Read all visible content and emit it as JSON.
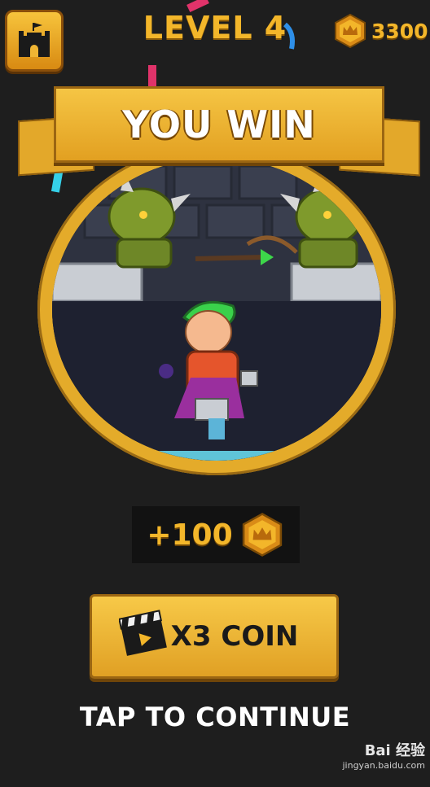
{
  "header": {
    "level_title": "LEVEL 4",
    "coins": "3300",
    "home_icon": "castle-icon"
  },
  "banner": {
    "title": "YOU WIN"
  },
  "reward": {
    "amount": "+100",
    "icon": "crown-coin-icon"
  },
  "actions": {
    "x3_label": "X3 COIN",
    "x3_icon": "clapperboard-icon",
    "continue_label": "TAP TO CONTINUE"
  },
  "watermark": {
    "logo": "Bai 经验",
    "url": "jingyan.baidu.com"
  },
  "colors": {
    "background": "#1e1e1e",
    "gold": "#f3b62a",
    "banner": "#e3a82a",
    "text_white": "#ffffff"
  }
}
